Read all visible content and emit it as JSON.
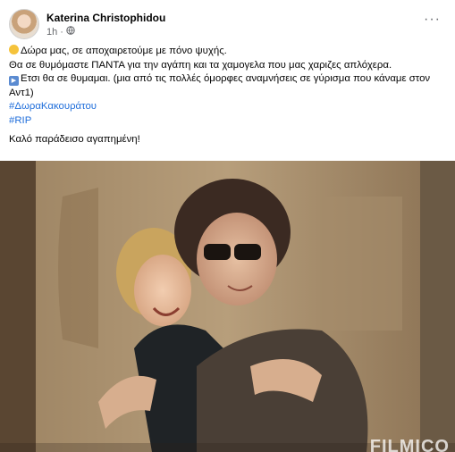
{
  "post": {
    "author": "Katerina Christophidou",
    "time": "1h",
    "separator": "·",
    "more_label": "···",
    "lines": {
      "line1": "Δώρα μας, σε αποχαιρετούμε με πόνο ψυχής.",
      "line2": "Θα σε θυμόμαστε ΠΑΝΤΑ για την αγάπη και τα χαμογελα που μας χαριζες απλόχερα.",
      "line3": "Ετσι θα σε θυμαμαι. (μια από τις πολλές όμορφες αναμνήσεις σε γύρισμα που κάναμε στον Αντ1)",
      "hashtag1": "#ΔωραΚακουράτου",
      "hashtag2": "#RIP",
      "line4": "Καλό παράδεισο αγαπημένη!"
    },
    "icons": {
      "emoji1": "sad-face-emoji-icon",
      "emoji2": "play-button-emoji-icon",
      "privacy": "globe-icon"
    },
    "video": {
      "watermark": "FILMICO"
    }
  },
  "colors": {
    "link": "#216fdb",
    "meta": "#65676b",
    "text": "#050505"
  }
}
